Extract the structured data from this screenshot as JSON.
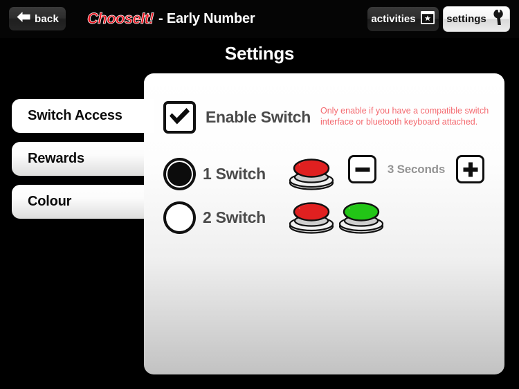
{
  "app": {
    "brand": "ChooseIt!",
    "title_rest": "- Early Number",
    "page_title": "Settings"
  },
  "topbar": {
    "back_label": "back",
    "back_icon": "left-arrow-icon",
    "activities_label": "activities",
    "activities_icon": "window-star-icon",
    "settings_label": "settings",
    "settings_icon": "wrench-icon"
  },
  "sidebar": {
    "items": [
      {
        "label": "Switch Access",
        "active": true
      },
      {
        "label": "Rewards",
        "active": false
      },
      {
        "label": "Colour",
        "active": false
      }
    ]
  },
  "panel": {
    "enable_switch": {
      "label": "Enable Switch",
      "checked": true,
      "icon": "checkmark-icon"
    },
    "warning_note": "Only enable if you have a compatible switch interface or bluetooth keyboard attached.",
    "options": [
      {
        "label": "1 Switch",
        "selected": true,
        "switches": [
          "red-switch-icon"
        ]
      },
      {
        "label": "2 Switch",
        "selected": false,
        "switches": [
          "red-switch-icon",
          "green-switch-icon"
        ]
      }
    ],
    "scan_stepper": {
      "value": "3 Seconds",
      "minus_label": "minus-icon",
      "plus_label": "plus-icon"
    }
  },
  "colors": {
    "brand_red": "#e8141e",
    "warning_text": "#f46a70",
    "switch_red": "#e02020",
    "switch_green": "#22c516",
    "background": "#000000",
    "panel_top": "#ffffff",
    "panel_bottom": "#c2c2c2",
    "label_gray": "#4a4a4a",
    "value_gray": "#949494"
  }
}
